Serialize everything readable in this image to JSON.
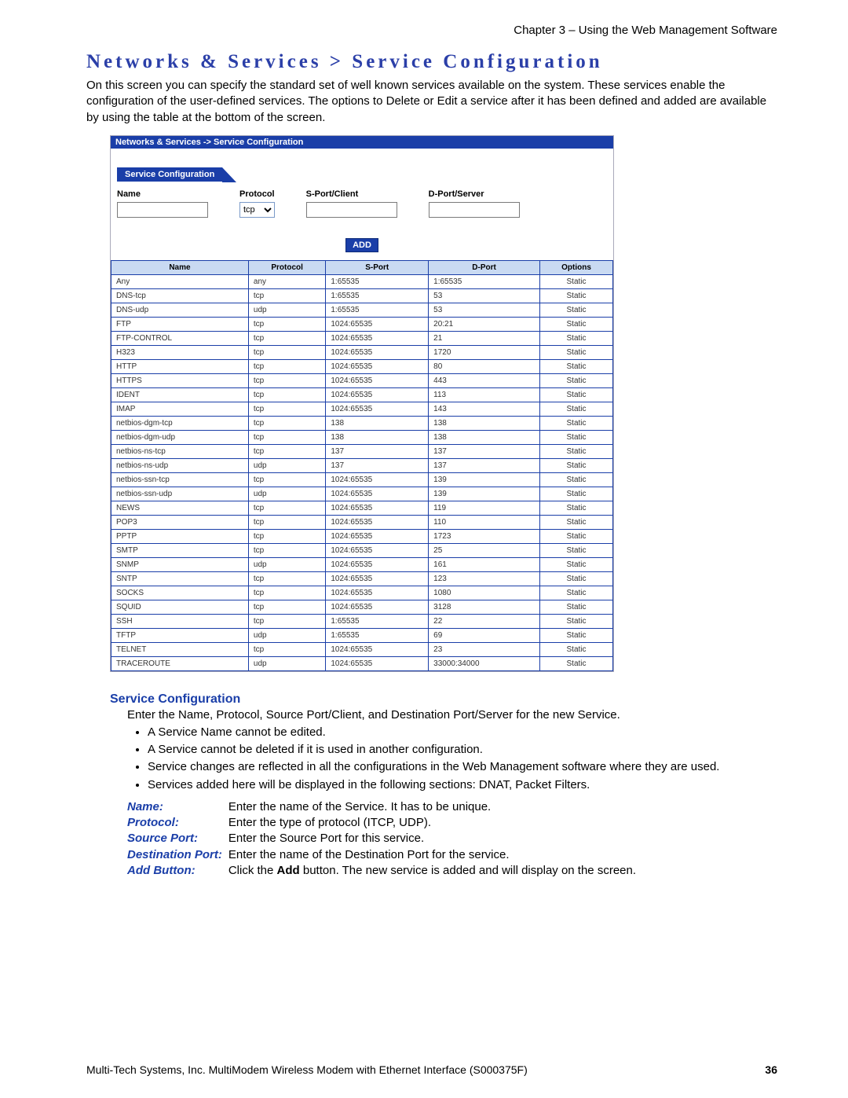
{
  "chapterHeader": "Chapter 3 – Using the Web Management Software",
  "pageTitle": "Networks & Services > Service Configuration",
  "introText": "On this screen you can specify the standard set of well known services available on the system. These services enable the configuration of the user-defined services. The options to Delete or Edit a service after it has been defined and added are available by using the table at the bottom of the screen.",
  "panel": {
    "breadcrumb": "Networks & Services  ->  Service Configuration",
    "sectionTab": "Service Configuration",
    "form": {
      "nameLabel": "Name",
      "protocolLabel": "Protocol",
      "protocolValue": "tcp",
      "sportLabel": "S-Port/Client",
      "dportLabel": "D-Port/Server",
      "addBtn": "ADD"
    },
    "tableHeaders": [
      "Name",
      "Protocol",
      "S-Port",
      "D-Port",
      "Options"
    ],
    "rows": [
      [
        "Any",
        "any",
        "1:65535",
        "1:65535",
        "Static"
      ],
      [
        "DNS-tcp",
        "tcp",
        "1:65535",
        "53",
        "Static"
      ],
      [
        "DNS-udp",
        "udp",
        "1:65535",
        "53",
        "Static"
      ],
      [
        "FTP",
        "tcp",
        "1024:65535",
        "20:21",
        "Static"
      ],
      [
        "FTP-CONTROL",
        "tcp",
        "1024:65535",
        "21",
        "Static"
      ],
      [
        "H323",
        "tcp",
        "1024:65535",
        "1720",
        "Static"
      ],
      [
        "HTTP",
        "tcp",
        "1024:65535",
        "80",
        "Static"
      ],
      [
        "HTTPS",
        "tcp",
        "1024:65535",
        "443",
        "Static"
      ],
      [
        "IDENT",
        "tcp",
        "1024:65535",
        "113",
        "Static"
      ],
      [
        "IMAP",
        "tcp",
        "1024:65535",
        "143",
        "Static"
      ],
      [
        "netbios-dgm-tcp",
        "tcp",
        "138",
        "138",
        "Static"
      ],
      [
        "netbios-dgm-udp",
        "tcp",
        "138",
        "138",
        "Static"
      ],
      [
        "netbios-ns-tcp",
        "tcp",
        "137",
        "137",
        "Static"
      ],
      [
        "netbios-ns-udp",
        "udp",
        "137",
        "137",
        "Static"
      ],
      [
        "netbios-ssn-tcp",
        "tcp",
        "1024:65535",
        "139",
        "Static"
      ],
      [
        "netbios-ssn-udp",
        "udp",
        "1024:65535",
        "139",
        "Static"
      ],
      [
        "NEWS",
        "tcp",
        "1024:65535",
        "119",
        "Static"
      ],
      [
        "POP3",
        "tcp",
        "1024:65535",
        "110",
        "Static"
      ],
      [
        "PPTP",
        "tcp",
        "1024:65535",
        "1723",
        "Static"
      ],
      [
        "SMTP",
        "tcp",
        "1024:65535",
        "25",
        "Static"
      ],
      [
        "SNMP",
        "udp",
        "1024:65535",
        "161",
        "Static"
      ],
      [
        "SNTP",
        "tcp",
        "1024:65535",
        "123",
        "Static"
      ],
      [
        "SOCKS",
        "tcp",
        "1024:65535",
        "1080",
        "Static"
      ],
      [
        "SQUID",
        "tcp",
        "1024:65535",
        "3128",
        "Static"
      ],
      [
        "SSH",
        "tcp",
        "1:65535",
        "22",
        "Static"
      ],
      [
        "TFTP",
        "udp",
        "1:65535",
        "69",
        "Static"
      ],
      [
        "TELNET",
        "tcp",
        "1024:65535",
        "23",
        "Static"
      ],
      [
        "TRACEROUTE",
        "udp",
        "1024:65535",
        "33000:34000",
        "Static"
      ]
    ]
  },
  "description": {
    "subhead": "Service Configuration",
    "intro": "Enter the Name, Protocol, Source Port/Client, and Destination Port/Server for the new Service.",
    "bullets": [
      "A Service Name cannot be edited.",
      "A Service cannot be deleted if it is used in another configuration.",
      "Service changes are reflected in all the configurations in the Web Management software where they are used.",
      "Services added here will be displayed in the following sections: DNAT, Packet Filters."
    ],
    "fields": [
      {
        "label": "Name:",
        "text": "Enter the name of the Service. It has to be unique."
      },
      {
        "label": "Protocol:",
        "text": "Enter the type of protocol (ITCP, UDP)."
      },
      {
        "label": "Source Port:",
        "text": "Enter the Source Port for this service."
      },
      {
        "label": "Destination Port:",
        "text": "Enter the name of the Destination Port for the service."
      },
      {
        "label": "Add Button:",
        "textPrefix": "Click the ",
        "bold": "Add",
        "textSuffix": " button. The new service is added and will display on the screen."
      }
    ]
  },
  "footer": {
    "text": "Multi-Tech Systems, Inc. MultiModem Wireless Modem with Ethernet Interface (S000375F)",
    "page": "36"
  }
}
